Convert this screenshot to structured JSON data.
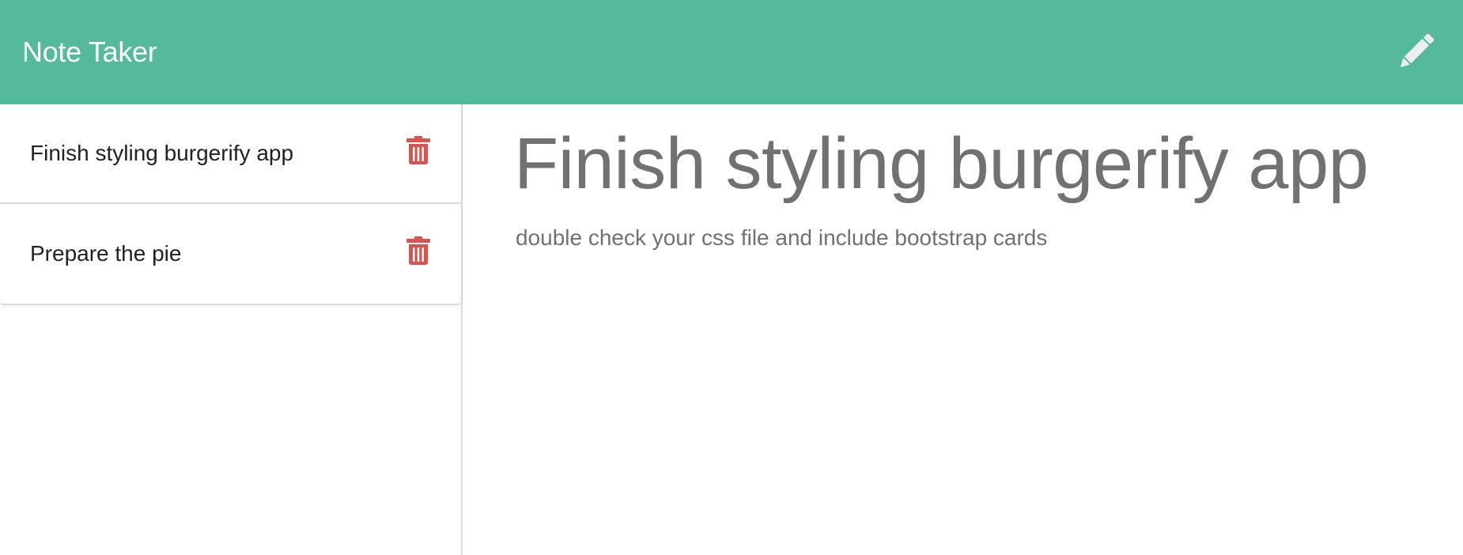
{
  "navbar": {
    "brand": "Note Taker",
    "new_note_icon": "pencil-icon"
  },
  "notes": [
    {
      "title": "Finish styling burgerify app",
      "delete_icon": "trash-icon"
    },
    {
      "title": "Prepare the pie",
      "delete_icon": "trash-icon"
    }
  ],
  "active_note": {
    "title": "Finish styling burgerify app",
    "text": "double check your css file and include bootstrap cards"
  },
  "colors": {
    "navbar": "#55b99c",
    "delete_icon": "#d9534f",
    "note_text": "#717171"
  }
}
